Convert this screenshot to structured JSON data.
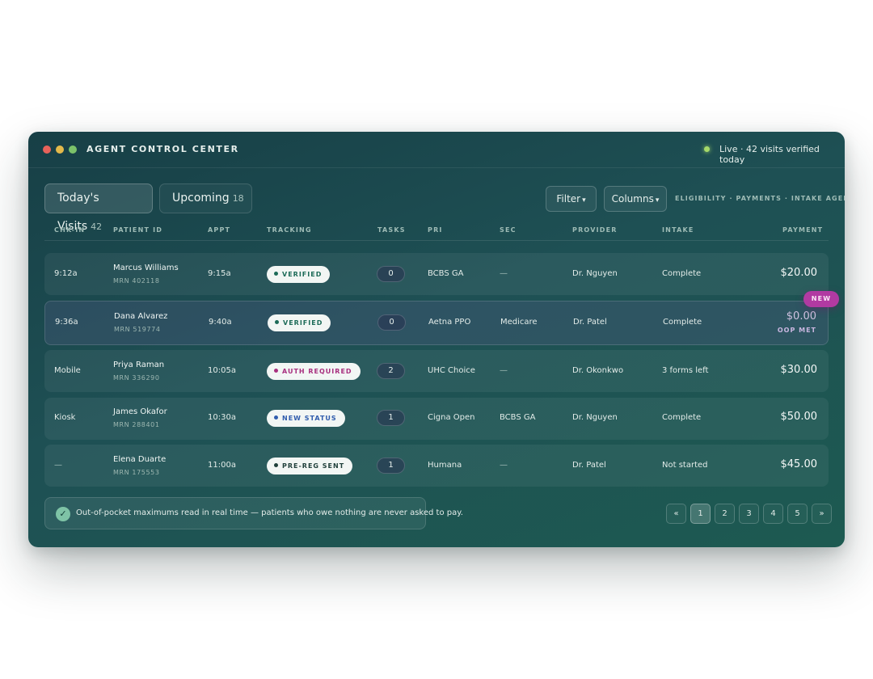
{
  "window": {
    "title": "AGENT CONTROL CENTER",
    "live_status": "Live · 42 visits verified today"
  },
  "tabs": [
    {
      "label": "Today's Visits",
      "count": "42",
      "active": true
    },
    {
      "label": "Upcoming",
      "count": "18",
      "active": false
    }
  ],
  "toolbar": {
    "filter_label": "Filter",
    "columns_label": "Columns",
    "caret": "▾",
    "agents_label": "ELIGIBILITY · PAYMENTS · INTAKE AGENTS"
  },
  "columns": [
    "CHK-IN",
    "PATIENT ID",
    "APPT",
    "TRACKING",
    "TASKS",
    "PRI",
    "SEC",
    "PROVIDER",
    "INTAKE",
    "PAYMENT"
  ],
  "rows": [
    {
      "checkin": "9:12a",
      "name": "Marcus Williams",
      "mrn": "MRN 402118",
      "appt": "9:15a",
      "tracking": "VERIFIED",
      "tasks": "0",
      "pri": "BCBS GA",
      "sec": "—",
      "provider": "Dr. Nguyen",
      "intake": "Complete",
      "payment": "$20.00"
    },
    {
      "checkin": "9:36a",
      "name": "Dana Alvarez",
      "mrn": "MRN 519774",
      "appt": "9:40a",
      "tracking": "VERIFIED",
      "tasks": "0",
      "pri": "Aetna PPO",
      "sec": "Medicare",
      "provider": "Dr. Patel",
      "intake": "Complete",
      "payment": "$0.00",
      "payment_note": "OOP MET",
      "badge": "NEW"
    },
    {
      "checkin": "Mobile",
      "name": "Priya Raman",
      "mrn": "MRN 336290",
      "appt": "10:05a",
      "tracking": "AUTH REQUIRED",
      "tasks": "2",
      "pri": "UHC Choice",
      "sec": "—",
      "provider": "Dr. Okonkwo",
      "intake": "3 forms left",
      "payment": "$30.00"
    },
    {
      "checkin": "Kiosk",
      "name": "James Okafor",
      "mrn": "MRN 288401",
      "appt": "10:30a",
      "tracking": "NEW STATUS",
      "tasks": "1",
      "pri": "Cigna Open",
      "sec": "BCBS GA",
      "provider": "Dr. Nguyen",
      "intake": "Complete",
      "payment": "$50.00"
    },
    {
      "checkin": "—",
      "name": "Elena Duarte",
      "mrn": "MRN 175553",
      "appt": "11:00a",
      "tracking": "PRE-REG SENT",
      "tasks": "1",
      "pri": "Humana",
      "sec": "—",
      "provider": "Dr. Patel",
      "intake": "Not started",
      "payment": "$45.00"
    }
  ],
  "footer": {
    "notice": "Out-of-pocket maximums read in real time — patients who owe nothing are never asked to pay.",
    "check_glyph": "✓"
  },
  "pagination": {
    "prev": "«",
    "pages": [
      "1",
      "2",
      "3",
      "4",
      "5"
    ],
    "current": "1",
    "next": "»"
  },
  "colors": {
    "accent_live": "#a6d96a",
    "badge_new": "#b13aa2",
    "verified": "#1d6b58",
    "auth_required": "#a8307f",
    "new_status": "#2f5cad"
  }
}
